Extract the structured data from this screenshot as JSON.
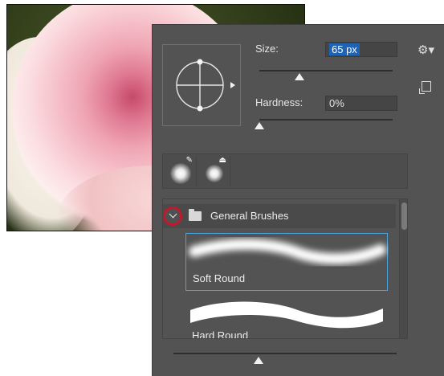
{
  "panel": {
    "size_label": "Size:",
    "size_value": "65 px",
    "hardness_label": "Hardness:",
    "hardness_value": "0%",
    "size_slider_fraction": 0.3,
    "hardness_slider_fraction": 0.0,
    "preview_slider_fraction": 0.38
  },
  "icons": {
    "settings": "gear-icon",
    "new_preset": "new-preset-icon",
    "expand": "chevron-down-icon",
    "folder": "folder-icon"
  },
  "brush_group": {
    "label": "General Brushes",
    "brushes": [
      {
        "name": "Soft Round",
        "selected": true
      },
      {
        "name": "Hard Round",
        "selected": false
      }
    ]
  },
  "colors": {
    "panel_bg": "#535353",
    "selection_blue": "#1f63b5",
    "highlight_ring": "#c1182c",
    "selected_border": "#4aa3df"
  }
}
